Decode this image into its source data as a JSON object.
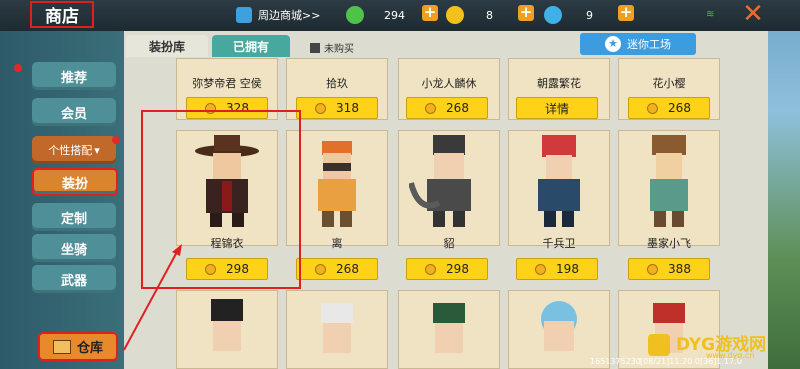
{
  "header": {
    "title": "商店",
    "link": "周边商城>>",
    "currency": [
      {
        "icon": "green-gem-icon",
        "value": "294"
      },
      {
        "icon": "gold-coin-icon",
        "value": "8"
      },
      {
        "icon": "blue-star-icon",
        "value": "9"
      }
    ]
  },
  "sidebar": {
    "items": [
      {
        "label": "推荐"
      },
      {
        "label": "会员"
      },
      {
        "label": "个性搭配"
      },
      {
        "label": "装扮"
      },
      {
        "label": "定制"
      },
      {
        "label": "坐骑"
      },
      {
        "label": "武器"
      }
    ],
    "warehouse": "仓库"
  },
  "tabs": {
    "library": "装扮库",
    "owned": "已拥有",
    "not_purchased": "未购买",
    "workshop": "迷你工场"
  },
  "row1": [
    {
      "name": "弥梦帝君 空侯",
      "price": "328"
    },
    {
      "name": "拾玖",
      "price": "318"
    },
    {
      "name": "小龙人麟休",
      "price": "268"
    },
    {
      "name": "朝露繁花",
      "price": "详情"
    },
    {
      "name": "花小樱",
      "price": "268"
    }
  ],
  "row2": [
    {
      "name": "程锦衣",
      "price": "298"
    },
    {
      "name": "离",
      "price": "268"
    },
    {
      "name": "貂",
      "price": "298"
    },
    {
      "name": "千兵卫",
      "price": "198"
    },
    {
      "name": "墨家小飞",
      "price": "388"
    }
  ],
  "footer": {
    "uid": "1651375230",
    "date": "[08/21]11:20 0",
    "ver": "[36]1.17.0"
  },
  "watermark": {
    "text": "DYG游戏网",
    "url": "www.dyg.cn"
  }
}
